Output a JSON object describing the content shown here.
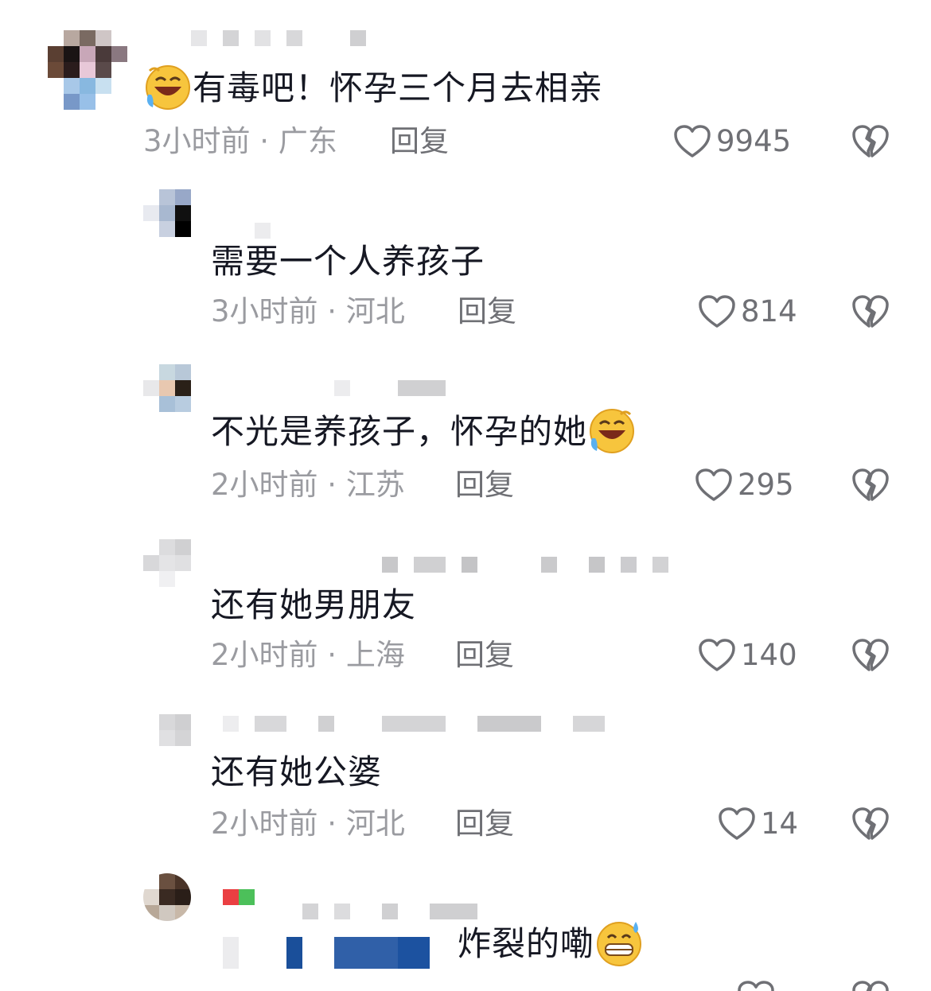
{
  "comments": [
    {
      "text": "有毒吧！怀孕三个月去相亲",
      "emoji_before": "laughing-crying-emoji",
      "meta": "3小时前 · 广东",
      "reply": "回复",
      "likes": "9945"
    },
    {
      "text": "需要一个人养孩子",
      "meta": "3小时前 · 河北",
      "reply": "回复",
      "likes": "814"
    },
    {
      "text": "不光是养孩子，怀孕的她",
      "emoji_after": "laughing-crying-emoji",
      "meta": "2小时前 · 江苏",
      "reply": "回复",
      "likes": "295"
    },
    {
      "text": "还有她男朋友",
      "meta": "2小时前 · 上海",
      "reply": "回复",
      "likes": "140"
    },
    {
      "text": "还有她公婆",
      "meta": "2小时前 · 河北",
      "reply": "回复",
      "likes": "14"
    },
    {
      "text": "炸裂的嘞",
      "emoji_after": "grinning-sweat-emoji"
    }
  ],
  "colors": {
    "text": "#161823",
    "meta": "#9a9ba0",
    "action": "#6f7075"
  }
}
